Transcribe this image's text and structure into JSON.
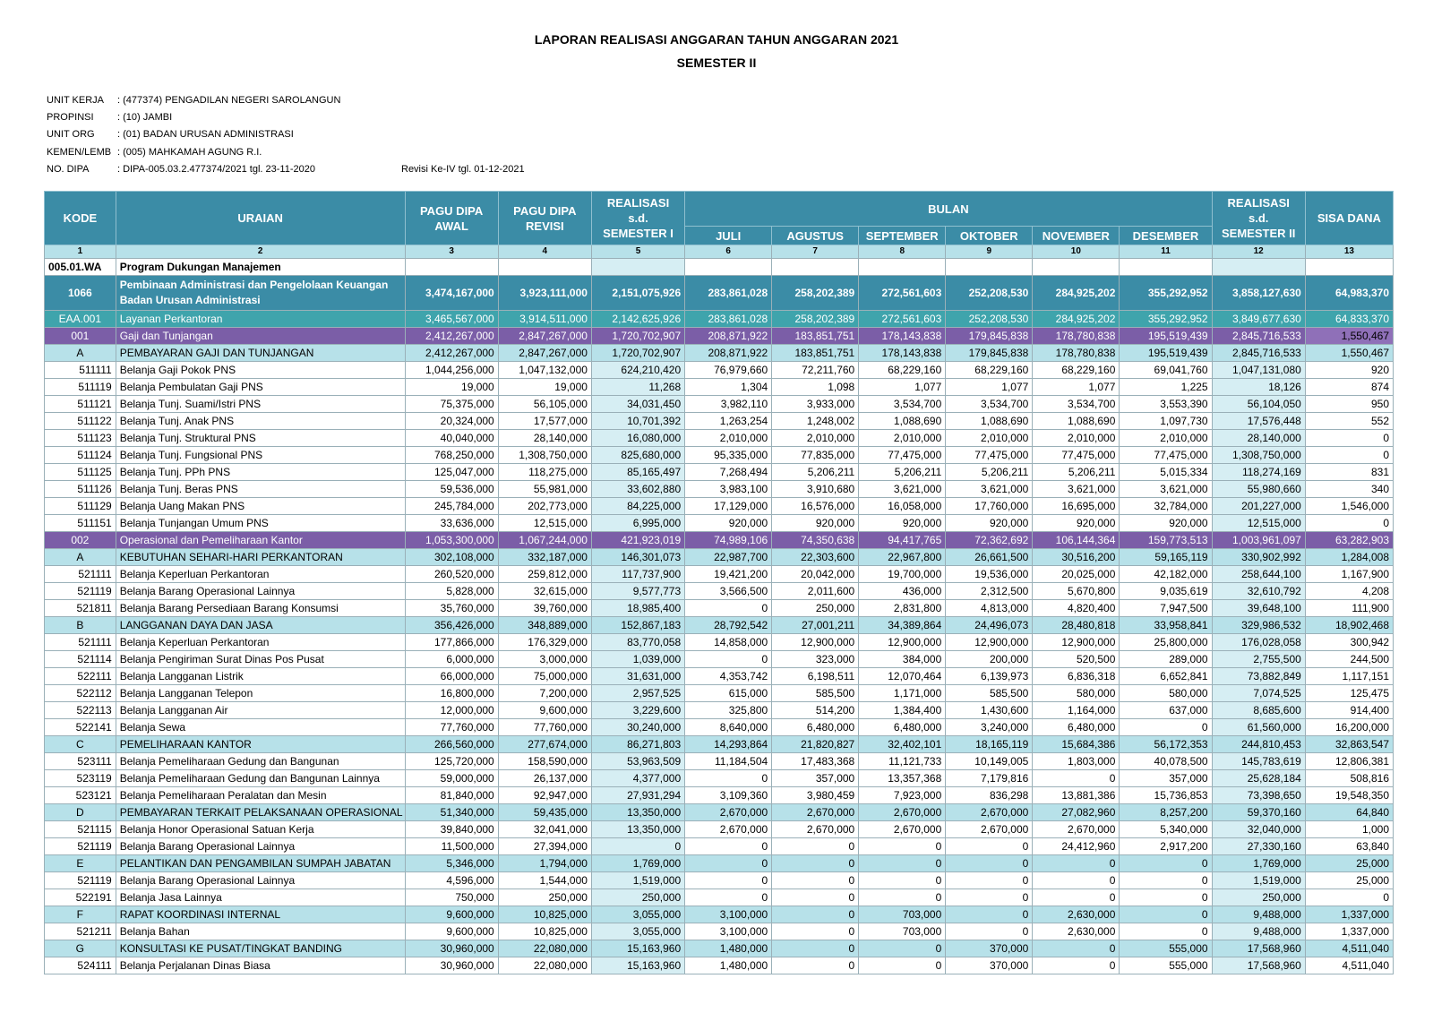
{
  "title": "LAPORAN REALISASI ANGGARAN TAHUN ANGGARAN 2021",
  "subtitle": "SEMESTER II",
  "meta": [
    {
      "key": "UNIT KERJA",
      "value": ": (477374) PENGADILAN NEGERI SAROLANGUN",
      "extra": ""
    },
    {
      "key": "PROPINSI",
      "value": ": (10) JAMBI",
      "extra": ""
    },
    {
      "key": "UNIT ORG",
      "value": ": (01) BADAN URUSAN ADMINISTRASI",
      "extra": ""
    },
    {
      "key": "KEMEN/LEMB",
      "value": ": (005) MAHKAMAH AGUNG R.I.",
      "extra": ""
    },
    {
      "key": "NO. DIPA",
      "value": ": DIPA-005.03.2.477374/2021 tgl. 23-11-2020",
      "extra": "Revisi Ke-IV tgl. 01-12-2021"
    }
  ],
  "headers": {
    "kode": "KODE",
    "uraian": "URAIAN",
    "pagu_awal": "PAGU DIPA AWAL",
    "pagu_revisi": "PAGU DIPA REVISI",
    "real_sem1": "REALISASI s.d. SEMESTER I",
    "bulan": "BULAN",
    "months": [
      "JULI",
      "AGUSTUS",
      "SEPTEMBER",
      "OKTOBER",
      "NOVEMBER",
      "DESEMBER"
    ],
    "real_sem2": "REALISASI s.d. SEMESTER II",
    "sisa": "SISA DANA",
    "colnums": [
      "1",
      "2",
      "3",
      "4",
      "5",
      "6",
      "7",
      "8",
      "9",
      "10",
      "11",
      "12",
      "13"
    ]
  },
  "rows": [
    {
      "type": "prog",
      "kode": "005.01.WA",
      "uraian": "Program Dukungan Manajemen",
      "vals": [
        "",
        "",
        "",
        "",
        "",
        "",
        "",
        "",
        "",
        "",
        ""
      ]
    },
    {
      "type": "kegiatan",
      "kode": "1066",
      "uraian": "Pembinaan Administrasi dan Pengelolaan Keuangan Badan Urusan Administrasi",
      "vals": [
        "3,474,167,000",
        "3,923,111,000",
        "2,151,075,926",
        "283,861,028",
        "258,202,389",
        "272,561,603",
        "252,208,530",
        "284,925,202",
        "355,292,952",
        "3,858,127,630",
        "64,983,370"
      ]
    },
    {
      "type": "output",
      "kode": "EAA.001",
      "uraian": "Layanan Perkantoran",
      "vals": [
        "3,465,567,000",
        "3,914,511,000",
        "2,142,625,926",
        "283,861,028",
        "258,202,389",
        "272,561,603",
        "252,208,530",
        "284,925,202",
        "355,292,952",
        "3,849,677,630",
        "64,833,370"
      ]
    },
    {
      "type": "komp",
      "kode": "001",
      "uraian": "Gaji dan Tunjangan",
      "vals": [
        "2,412,267,000",
        "2,847,267,000",
        "1,720,702,907",
        "208,871,922",
        "183,851,751",
        "178,143,838",
        "179,845,838",
        "178,780,838",
        "195,519,439",
        "2,845,716,533",
        "1,550,467"
      ]
    },
    {
      "type": "sub",
      "kode": "A",
      "uraian": "PEMBAYARAN GAJI DAN TUNJANGAN",
      "vals": [
        "2,412,267,000",
        "2,847,267,000",
        "1,720,702,907",
        "208,871,922",
        "183,851,751",
        "178,143,838",
        "179,845,838",
        "178,780,838",
        "195,519,439",
        "2,845,716,533",
        "1,550,467"
      ]
    },
    {
      "type": "item",
      "kode": "511111",
      "uraian": "Belanja Gaji Pokok PNS",
      "vals": [
        "1,044,256,000",
        "1,047,132,000",
        "624,210,420",
        "76,979,660",
        "72,211,760",
        "68,229,160",
        "68,229,160",
        "68,229,160",
        "69,041,760",
        "1,047,131,080",
        "920"
      ]
    },
    {
      "type": "item",
      "kode": "511119",
      "uraian": "Belanja Pembulatan Gaji PNS",
      "vals": [
        "19,000",
        "19,000",
        "11,268",
        "1,304",
        "1,098",
        "1,077",
        "1,077",
        "1,077",
        "1,225",
        "18,126",
        "874"
      ]
    },
    {
      "type": "item",
      "kode": "511121",
      "uraian": "Belanja Tunj. Suami/Istri PNS",
      "vals": [
        "75,375,000",
        "56,105,000",
        "34,031,450",
        "3,982,110",
        "3,933,000",
        "3,534,700",
        "3,534,700",
        "3,534,700",
        "3,553,390",
        "56,104,050",
        "950"
      ]
    },
    {
      "type": "item",
      "kode": "511122",
      "uraian": "Belanja Tunj. Anak PNS",
      "vals": [
        "20,324,000",
        "17,577,000",
        "10,701,392",
        "1,263,254",
        "1,248,002",
        "1,088,690",
        "1,088,690",
        "1,088,690",
        "1,097,730",
        "17,576,448",
        "552"
      ]
    },
    {
      "type": "item",
      "kode": "511123",
      "uraian": "Belanja Tunj. Struktural PNS",
      "vals": [
        "40,040,000",
        "28,140,000",
        "16,080,000",
        "2,010,000",
        "2,010,000",
        "2,010,000",
        "2,010,000",
        "2,010,000",
        "2,010,000",
        "28,140,000",
        "0"
      ]
    },
    {
      "type": "item",
      "kode": "511124",
      "uraian": "Belanja Tunj. Fungsional PNS",
      "vals": [
        "768,250,000",
        "1,308,750,000",
        "825,680,000",
        "95,335,000",
        "77,835,000",
        "77,475,000",
        "77,475,000",
        "77,475,000",
        "77,475,000",
        "1,308,750,000",
        "0"
      ]
    },
    {
      "type": "item",
      "kode": "511125",
      "uraian": "Belanja Tunj. PPh PNS",
      "vals": [
        "125,047,000",
        "118,275,000",
        "85,165,497",
        "7,268,494",
        "5,206,211",
        "5,206,211",
        "5,206,211",
        "5,206,211",
        "5,015,334",
        "118,274,169",
        "831"
      ]
    },
    {
      "type": "item",
      "kode": "511126",
      "uraian": "Belanja Tunj. Beras PNS",
      "vals": [
        "59,536,000",
        "55,981,000",
        "33,602,880",
        "3,983,100",
        "3,910,680",
        "3,621,000",
        "3,621,000",
        "3,621,000",
        "3,621,000",
        "55,980,660",
        "340"
      ]
    },
    {
      "type": "item",
      "kode": "511129",
      "uraian": "Belanja Uang Makan PNS",
      "vals": [
        "245,784,000",
        "202,773,000",
        "84,225,000",
        "17,129,000",
        "16,576,000",
        "16,058,000",
        "17,760,000",
        "16,695,000",
        "32,784,000",
        "201,227,000",
        "1,546,000"
      ]
    },
    {
      "type": "item",
      "kode": "511151",
      "uraian": "Belanja Tunjangan Umum PNS",
      "vals": [
        "33,636,000",
        "12,515,000",
        "6,995,000",
        "920,000",
        "920,000",
        "920,000",
        "920,000",
        "920,000",
        "920,000",
        "12,515,000",
        "0"
      ]
    },
    {
      "type": "komp",
      "kode": "002",
      "uraian": "Operasional dan Pemeliharaan Kantor",
      "vals": [
        "1,053,300,000",
        "1,067,244,000",
        "421,923,019",
        "74,989,106",
        "74,350,638",
        "94,417,765",
        "72,362,692",
        "106,144,364",
        "159,773,513",
        "1,003,961,097",
        "63,282,903"
      ]
    },
    {
      "type": "sub",
      "kode": "A",
      "uraian": "KEBUTUHAN SEHARI-HARI PERKANTORAN",
      "vals": [
        "302,108,000",
        "332,187,000",
        "146,301,073",
        "22,987,700",
        "22,303,600",
        "22,967,800",
        "26,661,500",
        "30,516,200",
        "59,165,119",
        "330,902,992",
        "1,284,008"
      ]
    },
    {
      "type": "item",
      "kode": "521111",
      "uraian": "Belanja Keperluan Perkantoran",
      "vals": [
        "260,520,000",
        "259,812,000",
        "117,737,900",
        "19,421,200",
        "20,042,000",
        "19,700,000",
        "19,536,000",
        "20,025,000",
        "42,182,000",
        "258,644,100",
        "1,167,900"
      ]
    },
    {
      "type": "item",
      "kode": "521119",
      "uraian": "Belanja Barang Operasional Lainnya",
      "vals": [
        "5,828,000",
        "32,615,000",
        "9,577,773",
        "3,566,500",
        "2,011,600",
        "436,000",
        "2,312,500",
        "5,670,800",
        "9,035,619",
        "32,610,792",
        "4,208"
      ]
    },
    {
      "type": "item",
      "kode": "521811",
      "uraian": "Belanja Barang Persediaan Barang Konsumsi",
      "vals": [
        "35,760,000",
        "39,760,000",
        "18,985,400",
        "0",
        "250,000",
        "2,831,800",
        "4,813,000",
        "4,820,400",
        "7,947,500",
        "39,648,100",
        "111,900"
      ]
    },
    {
      "type": "sub",
      "kode": "B",
      "uraian": "LANGGANAN DAYA DAN JASA",
      "vals": [
        "356,426,000",
        "348,889,000",
        "152,867,183",
        "28,792,542",
        "27,001,211",
        "34,389,864",
        "24,496,073",
        "28,480,818",
        "33,958,841",
        "329,986,532",
        "18,902,468"
      ]
    },
    {
      "type": "item",
      "kode": "521111",
      "uraian": "Belanja Keperluan Perkantoran",
      "vals": [
        "177,866,000",
        "176,329,000",
        "83,770,058",
        "14,858,000",
        "12,900,000",
        "12,900,000",
        "12,900,000",
        "12,900,000",
        "25,800,000",
        "176,028,058",
        "300,942"
      ]
    },
    {
      "type": "item",
      "kode": "521114",
      "uraian": "Belanja Pengiriman Surat Dinas Pos Pusat",
      "vals": [
        "6,000,000",
        "3,000,000",
        "1,039,000",
        "0",
        "323,000",
        "384,000",
        "200,000",
        "520,500",
        "289,000",
        "2,755,500",
        "244,500"
      ]
    },
    {
      "type": "item",
      "kode": "522111",
      "uraian": "Belanja Langganan Listrik",
      "vals": [
        "66,000,000",
        "75,000,000",
        "31,631,000",
        "4,353,742",
        "6,198,511",
        "12,070,464",
        "6,139,973",
        "6,836,318",
        "6,652,841",
        "73,882,849",
        "1,117,151"
      ]
    },
    {
      "type": "item",
      "kode": "522112",
      "uraian": "Belanja Langganan Telepon",
      "vals": [
        "16,800,000",
        "7,200,000",
        "2,957,525",
        "615,000",
        "585,500",
        "1,171,000",
        "585,500",
        "580,000",
        "580,000",
        "7,074,525",
        "125,475"
      ]
    },
    {
      "type": "item",
      "kode": "522113",
      "uraian": "Belanja Langganan Air",
      "vals": [
        "12,000,000",
        "9,600,000",
        "3,229,600",
        "325,800",
        "514,200",
        "1,384,400",
        "1,430,600",
        "1,164,000",
        "637,000",
        "8,685,600",
        "914,400"
      ]
    },
    {
      "type": "item",
      "kode": "522141",
      "uraian": "Belanja Sewa",
      "vals": [
        "77,760,000",
        "77,760,000",
        "30,240,000",
        "8,640,000",
        "6,480,000",
        "6,480,000",
        "3,240,000",
        "6,480,000",
        "0",
        "61,560,000",
        "16,200,000"
      ]
    },
    {
      "type": "sub",
      "kode": "C",
      "uraian": "PEMELIHARAAN KANTOR",
      "vals": [
        "266,560,000",
        "277,674,000",
        "86,271,803",
        "14,293,864",
        "21,820,827",
        "32,402,101",
        "18,165,119",
        "15,684,386",
        "56,172,353",
        "244,810,453",
        "32,863,547"
      ]
    },
    {
      "type": "item",
      "kode": "523111",
      "uraian": "Belanja Pemeliharaan Gedung dan Bangunan",
      "vals": [
        "125,720,000",
        "158,590,000",
        "53,963,509",
        "11,184,504",
        "17,483,368",
        "11,121,733",
        "10,149,005",
        "1,803,000",
        "40,078,500",
        "145,783,619",
        "12,806,381"
      ]
    },
    {
      "type": "item",
      "kode": "523119",
      "uraian": "Belanja Pemeliharaan Gedung dan Bangunan Lainnya",
      "vals": [
        "59,000,000",
        "26,137,000",
        "4,377,000",
        "0",
        "357,000",
        "13,357,368",
        "7,179,816",
        "0",
        "357,000",
        "25,628,184",
        "508,816"
      ]
    },
    {
      "type": "item",
      "kode": "523121",
      "uraian": "Belanja Pemeliharaan Peralatan dan Mesin",
      "vals": [
        "81,840,000",
        "92,947,000",
        "27,931,294",
        "3,109,360",
        "3,980,459",
        "7,923,000",
        "836,298",
        "13,881,386",
        "15,736,853",
        "73,398,650",
        "19,548,350"
      ]
    },
    {
      "type": "sub",
      "kode": "D",
      "uraian": "PEMBAYARAN TERKAIT PELAKSANAAN OPERASIONAL KA",
      "vals": [
        "51,340,000",
        "59,435,000",
        "13,350,000",
        "2,670,000",
        "2,670,000",
        "2,670,000",
        "2,670,000",
        "27,082,960",
        "8,257,200",
        "59,370,160",
        "64,840"
      ]
    },
    {
      "type": "item",
      "kode": "521115",
      "uraian": "Belanja Honor Operasional Satuan Kerja",
      "vals": [
        "39,840,000",
        "32,041,000",
        "13,350,000",
        "2,670,000",
        "2,670,000",
        "2,670,000",
        "2,670,000",
        "2,670,000",
        "5,340,000",
        "32,040,000",
        "1,000"
      ]
    },
    {
      "type": "item",
      "kode": "521119",
      "uraian": "Belanja Barang Operasional Lainnya",
      "vals": [
        "11,500,000",
        "27,394,000",
        "0",
        "0",
        "0",
        "0",
        "0",
        "24,412,960",
        "2,917,200",
        "27,330,160",
        "63,840"
      ]
    },
    {
      "type": "sub",
      "kode": "E",
      "uraian": "PELANTIKAN DAN PENGAMBILAN SUMPAH JABATAN",
      "vals": [
        "5,346,000",
        "1,794,000",
        "1,769,000",
        "0",
        "0",
        "0",
        "0",
        "0",
        "0",
        "1,769,000",
        "25,000"
      ]
    },
    {
      "type": "item",
      "kode": "521119",
      "uraian": "Belanja Barang Operasional Lainnya",
      "vals": [
        "4,596,000",
        "1,544,000",
        "1,519,000",
        "0",
        "0",
        "0",
        "0",
        "0",
        "0",
        "1,519,000",
        "25,000"
      ]
    },
    {
      "type": "item",
      "kode": "522191",
      "uraian": "Belanja Jasa Lainnya",
      "vals": [
        "750,000",
        "250,000",
        "250,000",
        "0",
        "0",
        "0",
        "0",
        "0",
        "0",
        "250,000",
        "0"
      ]
    },
    {
      "type": "sub",
      "kode": "F",
      "uraian": "RAPAT KOORDINASI INTERNAL",
      "vals": [
        "9,600,000",
        "10,825,000",
        "3,055,000",
        "3,100,000",
        "0",
        "703,000",
        "0",
        "2,630,000",
        "0",
        "9,488,000",
        "1,337,000"
      ]
    },
    {
      "type": "item",
      "kode": "521211",
      "uraian": "Belanja Bahan",
      "vals": [
        "9,600,000",
        "10,825,000",
        "3,055,000",
        "3,100,000",
        "0",
        "703,000",
        "0",
        "2,630,000",
        "0",
        "9,488,000",
        "1,337,000"
      ]
    },
    {
      "type": "sub",
      "kode": "G",
      "uraian": "KONSULTASI KE PUSAT/TINGKAT BANDING",
      "vals": [
        "30,960,000",
        "22,080,000",
        "15,163,960",
        "1,480,000",
        "0",
        "0",
        "370,000",
        "0",
        "555,000",
        "17,568,960",
        "4,511,040"
      ]
    },
    {
      "type": "item",
      "kode": "524111",
      "uraian": "Belanja Perjalanan Dinas Biasa",
      "vals": [
        "30,960,000",
        "22,080,000",
        "15,163,960",
        "1,480,000",
        "0",
        "0",
        "370,000",
        "0",
        "555,000",
        "17,568,960",
        "4,511,040"
      ]
    }
  ],
  "colors": {
    "header": "#3b8ca6",
    "output": "#3fa4ac",
    "komponen": "#7b5ea7",
    "sub": "#b7e1e9"
  }
}
